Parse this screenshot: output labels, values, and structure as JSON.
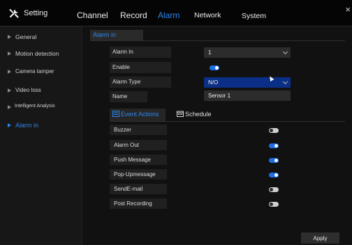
{
  "header": {
    "app_title": "Setting",
    "tabs": [
      {
        "label": "Channel",
        "active": false
      },
      {
        "label": "Record",
        "active": false
      },
      {
        "label": "Alarm",
        "active": true
      },
      {
        "label": "Network",
        "active": false
      },
      {
        "label": "System",
        "active": false
      }
    ],
    "close_glyph": "×"
  },
  "sidebar": {
    "items": [
      {
        "label": "General",
        "active": false
      },
      {
        "label": "Motion detection",
        "active": false
      },
      {
        "label": "Camera tamper",
        "active": false
      },
      {
        "label": "Video loss",
        "active": false
      },
      {
        "label": "Intelligent Analysis",
        "active": false
      },
      {
        "label": "Alarm in",
        "active": true
      }
    ]
  },
  "main": {
    "section_title": "Alarm in",
    "fields": {
      "alarm_in": {
        "label": "Alarm In",
        "value": "1"
      },
      "enable": {
        "label": "Enable",
        "state": "on"
      },
      "alarm_type": {
        "label": "Alarm Type",
        "value": "N/O"
      },
      "name": {
        "label": "Name",
        "value": "Sensor 1"
      }
    },
    "subtabs": [
      {
        "label": "Event Actions",
        "active": true
      },
      {
        "label": "Schedule",
        "active": false
      }
    ],
    "actions": [
      {
        "label": "Buzzer",
        "state": "off"
      },
      {
        "label": "Alarm Out",
        "state": "on"
      },
      {
        "label": "Push Message",
        "state": "on"
      },
      {
        "label": "Pop-Upmessage",
        "state": "on"
      },
      {
        "label": "SendE-mail",
        "state": "off"
      },
      {
        "label": "Post Recording",
        "state": "off"
      }
    ],
    "apply_label": "Apply"
  },
  "colors": {
    "accent": "#2b86f0",
    "toggle_on": "#1f6ee6",
    "toggle_off": "#cfcfcf",
    "background": "#111111",
    "sidebar_bg": "#171717"
  },
  "icons": {
    "app": "tools-icon",
    "close": "close-icon",
    "event_actions": "event-actions-icon",
    "schedule": "calendar-icon",
    "dropdown": "chevron-down-icon"
  }
}
